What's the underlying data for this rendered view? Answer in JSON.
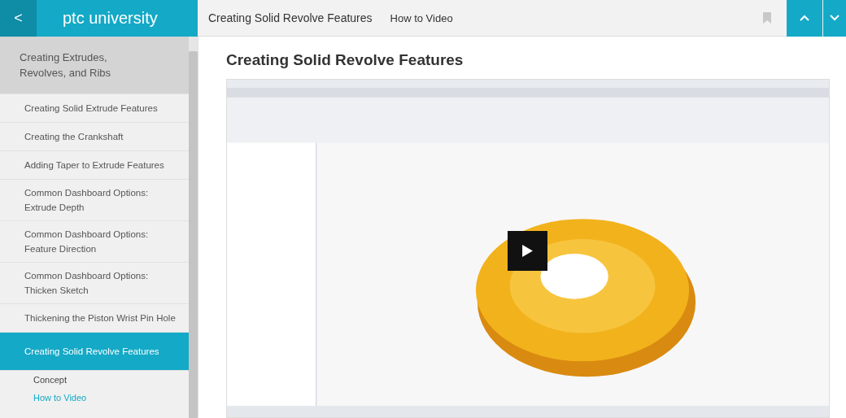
{
  "header": {
    "back": "<",
    "brand": "ptc university"
  },
  "topbar": {
    "title": "Creating Solid Revolve Features",
    "subtitle": "How to Video"
  },
  "sidebar": {
    "items": [
      {
        "kind": "section",
        "label": "Creating Extrudes, Revolves, and Ribs",
        "selected": true
      },
      {
        "kind": "lesson",
        "label": "Creating Solid Extrude Features",
        "selected": false
      },
      {
        "kind": "lesson",
        "label": "Creating the Crankshaft",
        "selected": false
      },
      {
        "kind": "lesson",
        "label": "Adding Taper to Extrude Features",
        "selected": false
      },
      {
        "kind": "lesson",
        "label": "Common Dashboard Options: Extrude Depth",
        "selected": false
      },
      {
        "kind": "lesson",
        "label": "Common Dashboard Options: Feature Direction",
        "selected": false
      },
      {
        "kind": "lesson",
        "label": "Common Dashboard Options: Thicken Sketch",
        "selected": false
      },
      {
        "kind": "lesson",
        "label": "Thickening the Piston Wrist Pin Hole",
        "selected": false
      },
      {
        "kind": "lesson",
        "label": "Creating Solid Revolve Features",
        "selected": true,
        "children": [
          {
            "label": "Concept",
            "selected": false
          },
          {
            "label": "How to Video",
            "selected": true
          }
        ]
      }
    ]
  },
  "content": {
    "heading": "Creating Solid Revolve Features"
  }
}
